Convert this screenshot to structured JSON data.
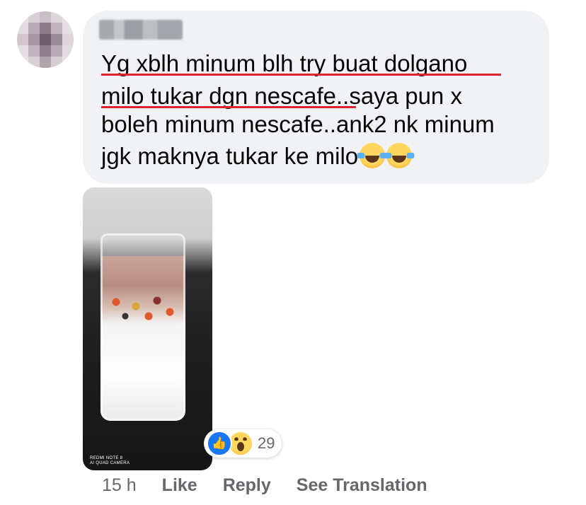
{
  "comment": {
    "lines": [
      "Yg xblh minum blh try buat dolgano",
      "milo tukar dgn nescafe..saya pun x",
      "boleh minum nescafe..ank2 nk minum",
      "jgk maknya tukar ke milo"
    ],
    "trailing_emojis": [
      "laughing-tears-emoji",
      "laughing-tears-emoji"
    ],
    "underline_color": "#e0242e"
  },
  "photo": {
    "watermark_line1": "REDMI NOTE 8",
    "watermark_line2": "AI QUAD CAMERA"
  },
  "reactions": {
    "icons": [
      "like-icon",
      "wow-icon"
    ],
    "count": "29"
  },
  "actions": {
    "time": "15 h",
    "like": "Like",
    "reply": "Reply",
    "see_translation": "See Translation"
  },
  "colors": {
    "bubble": "#f0f2f5",
    "meta_text": "#65676b",
    "like_blue": "#1877f2"
  }
}
